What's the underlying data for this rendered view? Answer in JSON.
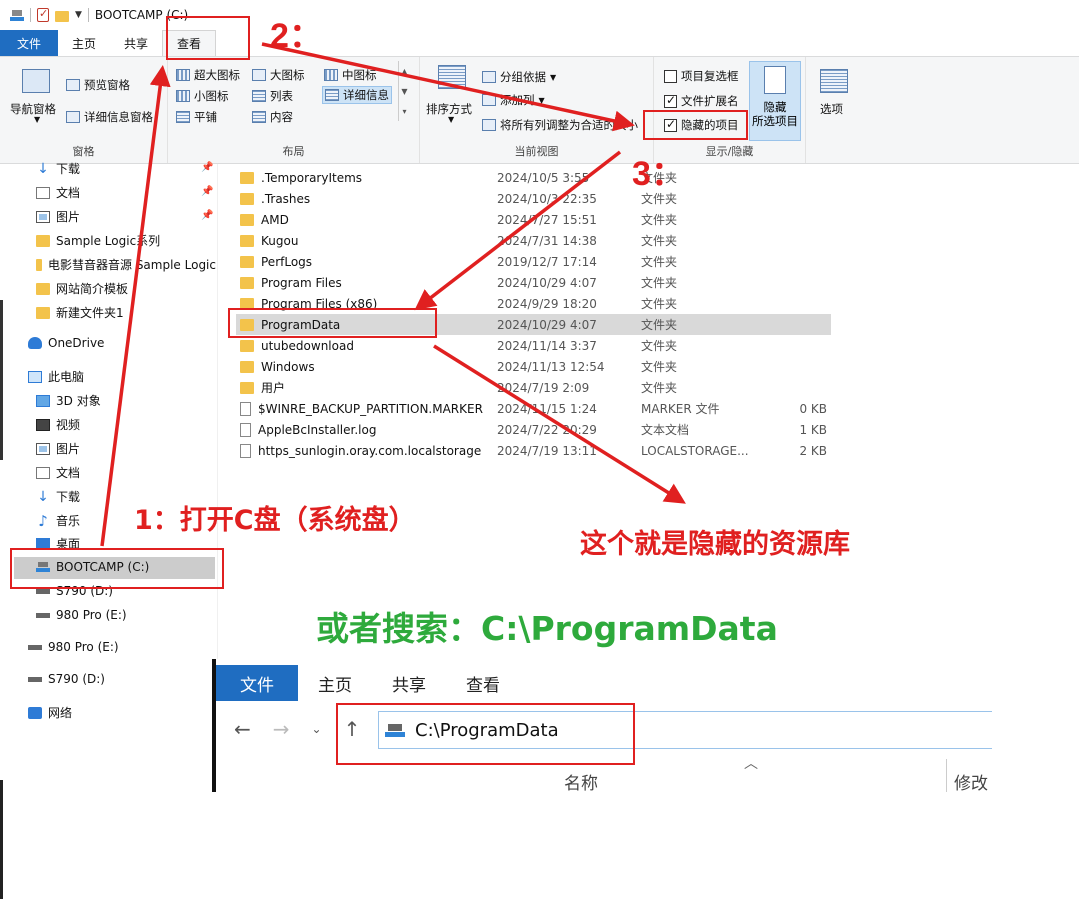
{
  "window": {
    "title": "BOOTCAMP (C:)"
  },
  "ribbon_tabs": [
    "文件",
    "主页",
    "共享",
    "查看"
  ],
  "ribbon": {
    "panes": {
      "nav_pane": "导航窗格",
      "preview_pane": "预览窗格",
      "details_pane": "详细信息窗格",
      "label": "窗格"
    },
    "layout": {
      "items": [
        "超大图标",
        "大图标",
        "中图标",
        "小图标",
        "列表",
        "详细信息",
        "平铺",
        "内容"
      ],
      "label": "布局"
    },
    "current_view": {
      "sort": "排序方式",
      "group_by": "分组依据",
      "add_column": "添加列",
      "fit_columns": "将所有列调整为合适的大小",
      "label": "当前视图"
    },
    "show_hide": {
      "item_checkboxes": "项目复选框",
      "file_extensions": "文件扩展名",
      "hidden_items": "隐藏的项目",
      "item_checkboxes_checked": false,
      "file_extensions_checked": true,
      "hidden_items_checked": true,
      "hide_selected_line1": "隐藏",
      "hide_selected_line2": "所选项目",
      "label": "显示/隐藏"
    },
    "options": "选项"
  },
  "nav_pane": {
    "quick": [
      "下载",
      "文档",
      "图片",
      "Sample Logic系列",
      "电影彗音器音源 Sample Logic",
      "网站简介模板",
      "新建文件夹1"
    ],
    "onedrive": "OneDrive",
    "this_pc": "此电脑",
    "pc_items": [
      "3D 对象",
      "视频",
      "图片",
      "文档",
      "下载",
      "音乐",
      "桌面",
      "BOOTCAMP (C:)",
      "S790 (D:)",
      "980 Pro (E:)"
    ],
    "drives": [
      "980 Pro (E:)",
      "S790 (D:)"
    ],
    "network": "网络"
  },
  "files": [
    {
      "name": ".TemporaryItems",
      "date": "2024/10/5 3:55",
      "type": "文件夹",
      "size": "",
      "icon": "folder"
    },
    {
      "name": ".Trashes",
      "date": "2024/10/3 22:35",
      "type": "文件夹",
      "size": "",
      "icon": "folder"
    },
    {
      "name": "AMD",
      "date": "2024/7/27 15:51",
      "type": "文件夹",
      "size": "",
      "icon": "folder"
    },
    {
      "name": "Kugou",
      "date": "2024/7/31 14:38",
      "type": "文件夹",
      "size": "",
      "icon": "folder"
    },
    {
      "name": "PerfLogs",
      "date": "2019/12/7 17:14",
      "type": "文件夹",
      "size": "",
      "icon": "folder"
    },
    {
      "name": "Program Files",
      "date": "2024/10/29 4:07",
      "type": "文件夹",
      "size": "",
      "icon": "folder"
    },
    {
      "name": "Program Files (x86)",
      "date": "2024/9/29 18:20",
      "type": "文件夹",
      "size": "",
      "icon": "folder"
    },
    {
      "name": "ProgramData",
      "date": "2024/10/29 4:07",
      "type": "文件夹",
      "size": "",
      "icon": "folder",
      "selected": true
    },
    {
      "name": "utubedownload",
      "date": "2024/11/14 3:37",
      "type": "文件夹",
      "size": "",
      "icon": "folder"
    },
    {
      "name": "Windows",
      "date": "2024/11/13 12:54",
      "type": "文件夹",
      "size": "",
      "icon": "folder"
    },
    {
      "name": "用户",
      "date": "2024/7/19 2:09",
      "type": "文件夹",
      "size": "",
      "icon": "folder"
    },
    {
      "name": "$WINRE_BACKUP_PARTITION.MARKER",
      "date": "2024/11/15 1:24",
      "type": "MARKER 文件",
      "size": "0 KB",
      "icon": "file"
    },
    {
      "name": "AppleBcInstaller.log",
      "date": "2024/7/22 20:29",
      "type": "文本文档",
      "size": "1 KB",
      "icon": "file"
    },
    {
      "name": "https_sunlogin.oray.com.localstorage",
      "date": "2024/7/19 13:11",
      "type": "LOCALSTORAGE...",
      "size": "2 KB",
      "icon": "file"
    }
  ],
  "annotations": {
    "step1": "1：打开C盘（系统盘）",
    "step2": "2：",
    "step3": "3：",
    "hidden_library": "这个就是隐藏的资源库",
    "or_search": "或者搜索：C:\\ProgramData",
    "color_red": "#e02020",
    "color_green": "#2eaa3c"
  },
  "inset": {
    "tabs": [
      "文件",
      "主页",
      "共享",
      "查看"
    ],
    "address": "C:\\ProgramData",
    "col_name": "名称",
    "col_modified": "修改"
  }
}
